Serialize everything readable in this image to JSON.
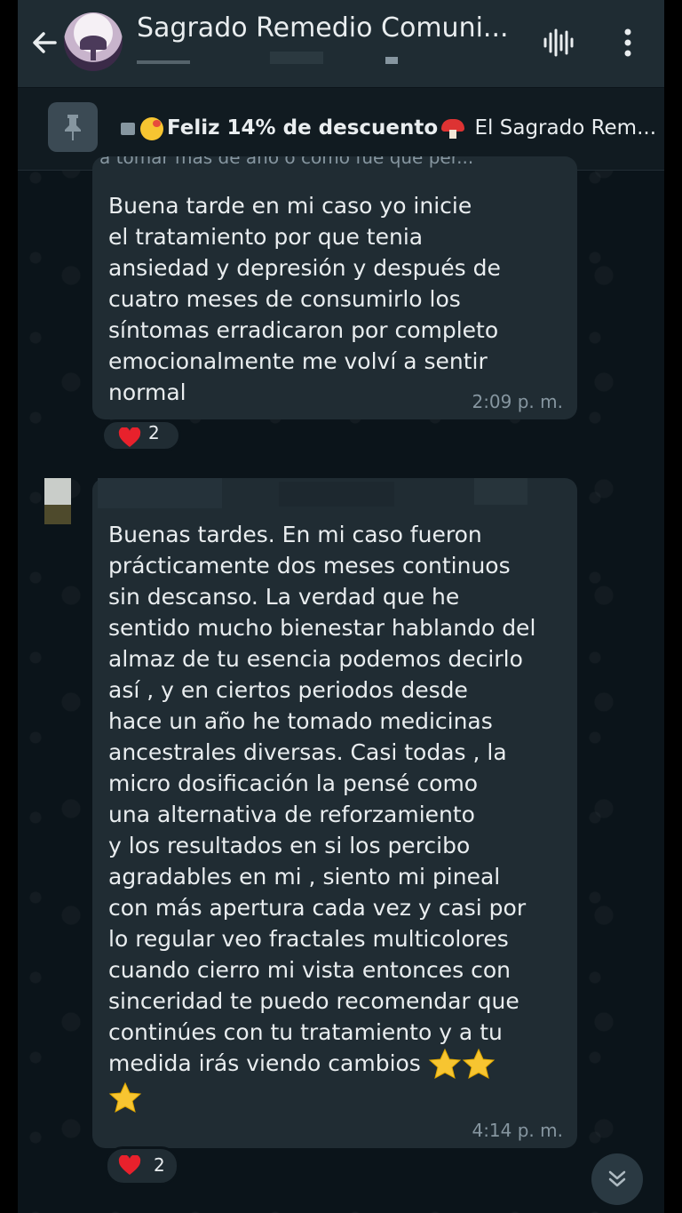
{
  "header": {
    "title": "Sagrado Remedio Comuni...",
    "avatar_text": "Sagrado Remedio"
  },
  "pinned": {
    "bold_text": "Feliz 14% de descuento",
    "rest_text": " El Sagrado Rem..."
  },
  "messages": [
    {
      "quote_text": "a tomar más de año o como fue que per...",
      "text": "Buena tarde en mi caso yo inicie\nel tratamiento por que tenia\nansiedad y depresión y después de\ncuatro meses de consumirlo los\nsíntomas erradicaron por completo\nemocionalmente me volví a sentir\nnormal",
      "time": "2:09 p. m.",
      "reaction_count": "2"
    },
    {
      "text": "Buenas tardes. En mi caso fueron\nprácticamente dos meses continuos\nsin descanso. La verdad que he\nsentido mucho bienestar hablando del\nalmaz de tu esencia podemos decirlo\nasí , y en ciertos periodos desde\nhace un año he tomado medicinas\nancestrales diversas. Casi todas , la\nmicro dosificación la pensé como\nuna alternativa de reforzamiento\ny los resultados en si los percibo\nagradables en mi ,  siento mi pineal\ncon más apertura cada vez y casi por\nlo regular veo fractales multicolores\ncuando cierro mi vista entonces con\nsinceridad te puedo recomendar que\ncontinúes con tu tratamiento y a tu",
      "last_line": "medida irás viendo cambios ",
      "time": "4:14 p. m.",
      "reaction_count": "2"
    }
  ],
  "colors": {
    "background": "#0b141a",
    "header": "#1f2c33",
    "bubble": "#202c33",
    "heart": "#e8212c",
    "star": "#f7c531"
  },
  "icons": {
    "back": "back-arrow-icon",
    "voice": "voice-call-icon",
    "menu": "kebab-menu-icon",
    "pin": "pin-icon",
    "scroll": "chevron-double-down-icon"
  }
}
